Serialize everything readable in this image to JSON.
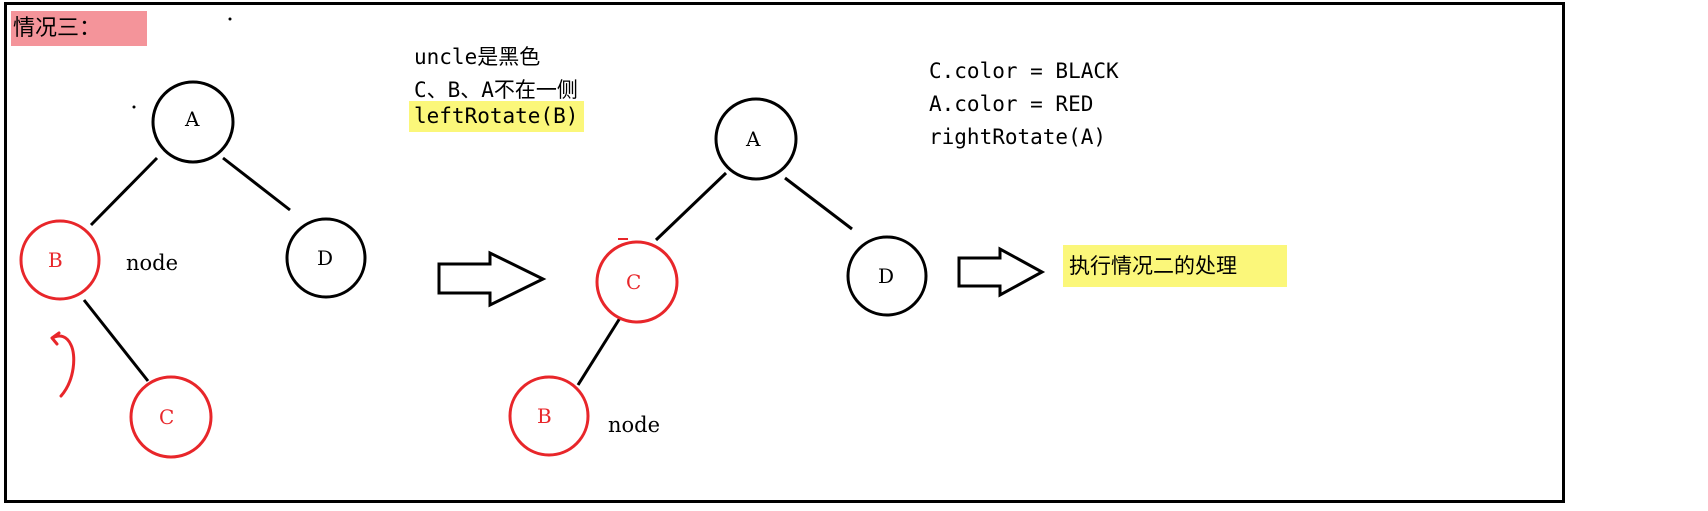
{
  "title": "情况三：",
  "step1": {
    "lines": [
      "uncle是黑色",
      "C、B、A不在一侧"
    ],
    "action": "leftRotate(B)"
  },
  "step2": {
    "lines": [
      "C.color = BLACK",
      "A.color = RED",
      "rightRotate(A)"
    ]
  },
  "result_text": "执行情况二的处理",
  "tree_before": {
    "nodes": [
      {
        "id": "A",
        "label": "A",
        "color": "black"
      },
      {
        "id": "B",
        "label": "B",
        "color": "red"
      },
      {
        "id": "C",
        "label": "C",
        "color": "red"
      },
      {
        "id": "D",
        "label": "D",
        "color": "black"
      }
    ],
    "node_tag": "node"
  },
  "tree_after": {
    "nodes": [
      {
        "id": "A",
        "label": "A",
        "color": "black"
      },
      {
        "id": "C",
        "label": "C",
        "color": "red"
      },
      {
        "id": "B",
        "label": "B",
        "color": "red"
      },
      {
        "id": "D",
        "label": "D",
        "color": "black"
      }
    ],
    "node_tag": "node"
  },
  "colors": {
    "red": "#e8262a",
    "black": "#000000",
    "highlight": "#fbf77a",
    "title_bg": "#f4949a"
  }
}
